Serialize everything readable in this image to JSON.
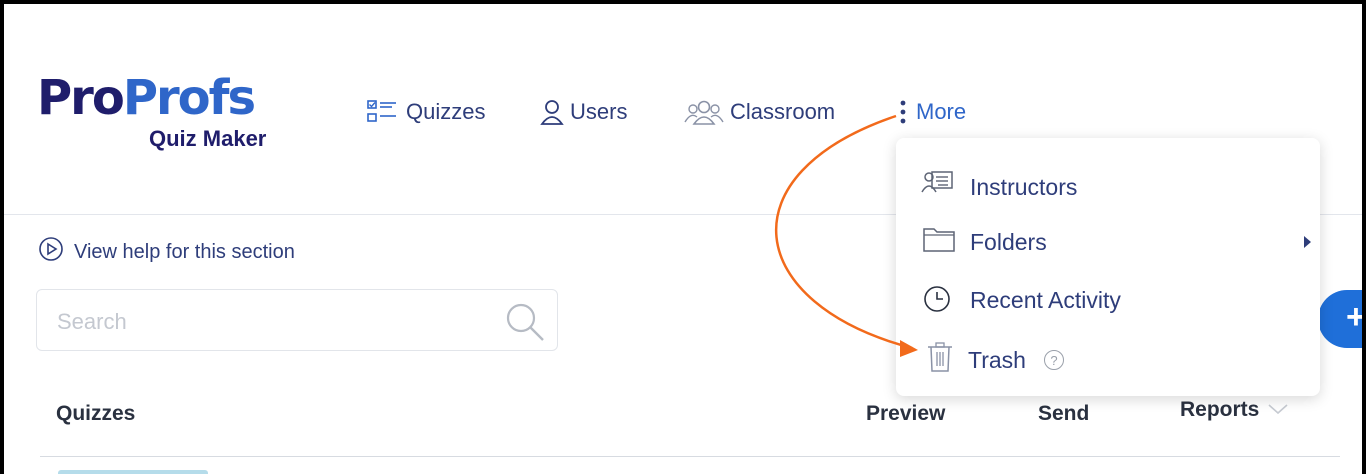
{
  "brand": {
    "name_part1": "Pro",
    "name_part2": "Profs",
    "product": "Quiz Maker"
  },
  "nav": {
    "quizzes": "Quizzes",
    "users": "Users",
    "classroom": "Classroom",
    "more": "More"
  },
  "help_link": "View help for this section",
  "search": {
    "placeholder": "Search",
    "value": ""
  },
  "table": {
    "headers": [
      "Quizzes",
      "Preview",
      "Send",
      "Reports"
    ]
  },
  "more_menu": {
    "items": [
      {
        "label": "Instructors",
        "icon": "instructor-icon"
      },
      {
        "label": "Folders",
        "icon": "folder-icon",
        "has_submenu": true
      },
      {
        "label": "Recent Activity",
        "icon": "clock-icon"
      },
      {
        "label": "Trash",
        "icon": "trash-icon"
      }
    ]
  },
  "colors": {
    "accent": "#2f66c9",
    "brand_dark": "#1f1d6b",
    "annotation_arrow": "#f26a1b",
    "add_button": "#1f6fd9"
  }
}
